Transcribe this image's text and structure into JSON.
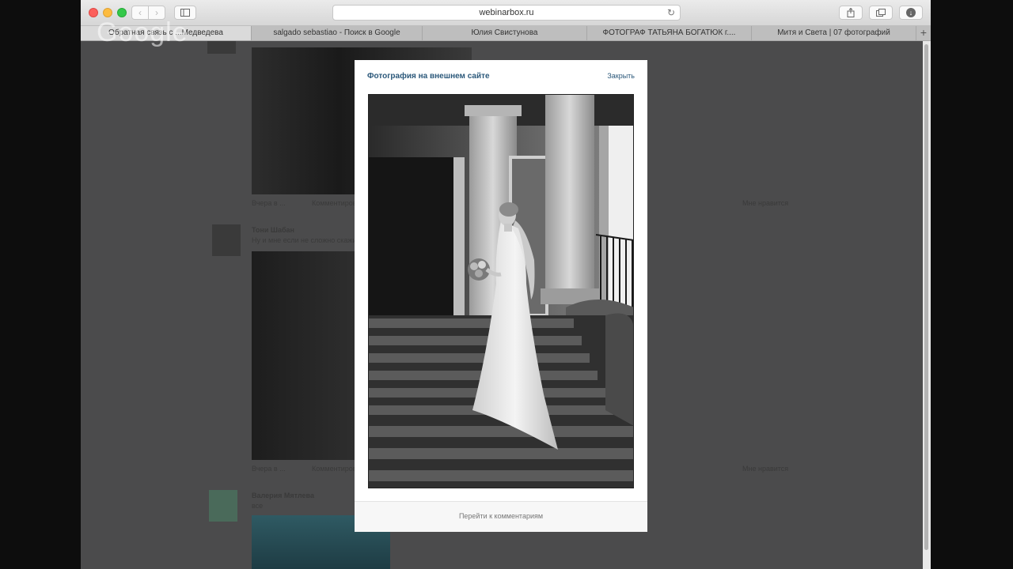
{
  "browser": {
    "url": "webinarbox.ru",
    "tabs": [
      {
        "label": "Обратная связь с ...Медведева",
        "active": true
      },
      {
        "label": "salgado sebastiao - Поиск в Google",
        "active": false
      },
      {
        "label": "Юлия Свистунова",
        "active": false
      },
      {
        "label": "ФОТОГРАФ ТАТЬЯНА БОГАТЮК г....",
        "active": false
      },
      {
        "label": "Митя и Света | 07 фотографий",
        "active": false
      }
    ],
    "new_tab_glyph": "+",
    "icons": {
      "back": "chevron-left-icon",
      "forward": "chevron-right-icon",
      "sidebar": "sidebar-icon",
      "reload": "reload-icon",
      "share": "share-icon",
      "tabs": "tabs-overview-icon",
      "downloads": "download-icon"
    }
  },
  "overlay": {
    "google_watermark": "Google"
  },
  "background_page": {
    "post1": {
      "date": "Вчера в ...",
      "comment": "Комментировать",
      "like": "Мне нравится"
    },
    "post2": {
      "author": "Тони Шабан",
      "text": "Ну и мне если не сложно скажи...",
      "date": "Вчера в ...",
      "comment": "Комментировать",
      "like": "Мне нравится"
    },
    "post3": {
      "author": "Валерия Мятлева",
      "text": "все"
    }
  },
  "modal": {
    "title": "Фотография на внешнем сайте",
    "close_label": "Закрыть",
    "footer_link": "Перейти к комментариям"
  }
}
